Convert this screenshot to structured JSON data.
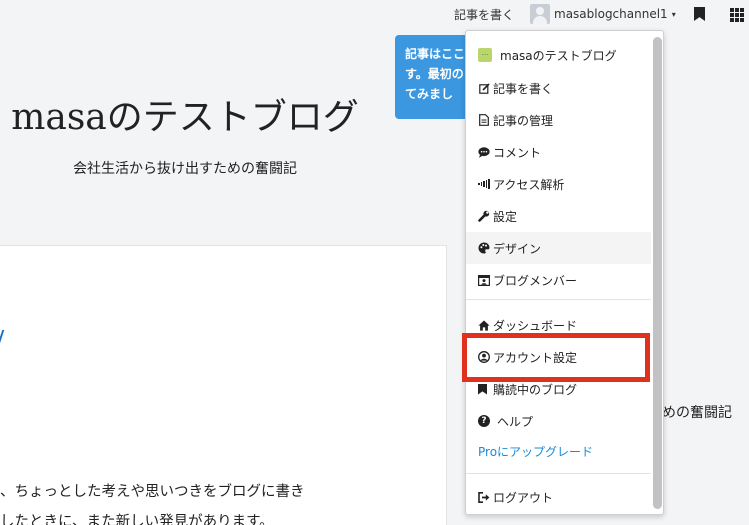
{
  "topbar": {
    "write_label": "記事を書く",
    "username": "masablogchannel1",
    "caret": "▾"
  },
  "blog": {
    "title": "masaのテストブログ",
    "description": "会社生活から抜け出すための奮闘記"
  },
  "tooltip": {
    "lines": [
      "記事はここ",
      "す。最初の",
      "てみまし"
    ]
  },
  "article": {
    "line1": "、ちょっとした考えや思いつきをブログに書き",
    "line2": "したときに、また新しい発見があります。",
    "side_text": "めの奮闘記"
  },
  "menu": {
    "blog_name": "masaのテストブログ",
    "items": [
      {
        "label": "記事を書く",
        "icon": "edit-icon"
      },
      {
        "label": "記事の管理",
        "icon": "document-icon"
      },
      {
        "label": "コメント",
        "icon": "comment-icon"
      },
      {
        "label": "アクセス解析",
        "icon": "signal-icon"
      },
      {
        "label": "設定",
        "icon": "wrench-icon"
      },
      {
        "label": "デザイン",
        "icon": "palette-icon"
      },
      {
        "label": "ブログメンバー",
        "icon": "members-icon"
      },
      {
        "label": "ダッシュボード",
        "icon": "home-icon"
      },
      {
        "label": "アカウント設定",
        "icon": "user-circle-icon"
      },
      {
        "label": "購読中のブログ",
        "icon": "bookmark-icon"
      },
      {
        "label": "ヘルプ",
        "icon": "help-icon"
      },
      {
        "label": "Proにアップグレード",
        "icon": ""
      },
      {
        "label": "ログアウト",
        "icon": "logout-icon"
      }
    ]
  },
  "colors": {
    "accent_blue": "#3b97e0",
    "pro_link": "#1a8ad9",
    "highlight_red": "#e0301e"
  }
}
